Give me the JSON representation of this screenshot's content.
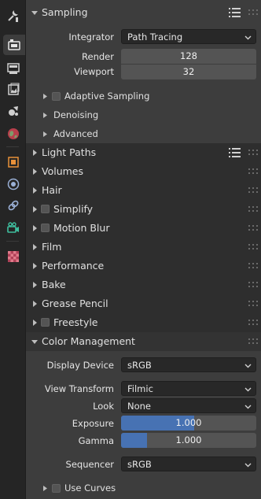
{
  "tabs": [
    {
      "name": "tool-tab-icon"
    },
    {
      "name": "render-tab-icon"
    },
    {
      "name": "output-tab-icon"
    },
    {
      "name": "view-layer-tab-icon"
    },
    {
      "name": "scene-tab-icon"
    },
    {
      "name": "world-tab-icon"
    },
    {
      "name": "object-tab-icon"
    },
    {
      "name": "modifier-tab-icon"
    },
    {
      "name": "physics-tab-icon"
    },
    {
      "name": "constraints-tab-icon"
    },
    {
      "name": "data-tab-icon"
    },
    {
      "name": "texture-tab-icon"
    }
  ],
  "sampling": {
    "title": "Sampling",
    "integrator_label": "Integrator",
    "integrator_value": "Path Tracing",
    "render_label": "Render",
    "render_value": "128",
    "viewport_label": "Viewport",
    "viewport_value": "32",
    "sub": [
      "Adaptive Sampling",
      "Denoising",
      "Advanced"
    ]
  },
  "panels": {
    "light_paths": "Light Paths",
    "volumes": "Volumes",
    "hair": "Hair",
    "simplify": "Simplify",
    "motion_blur": "Motion Blur",
    "film": "Film",
    "performance": "Performance",
    "bake": "Bake",
    "grease_pencil": "Grease Pencil",
    "freestyle": "Freestyle"
  },
  "color_management": {
    "title": "Color Management",
    "display_device_label": "Display Device",
    "display_device_value": "sRGB",
    "view_transform_label": "View Transform",
    "view_transform_value": "Filmic",
    "look_label": "Look",
    "look_value": "None",
    "exposure_label": "Exposure",
    "exposure_value": "1.000",
    "exposure_fraction": 0.54,
    "gamma_label": "Gamma",
    "gamma_value": "1.000",
    "gamma_fraction": 0.19,
    "sequencer_label": "Sequencer",
    "sequencer_value": "sRGB",
    "use_curves_label": "Use Curves"
  },
  "colors": {
    "accent": "#4772b3",
    "background": "#303030",
    "field": "#545454",
    "dropdown": "#282828"
  }
}
